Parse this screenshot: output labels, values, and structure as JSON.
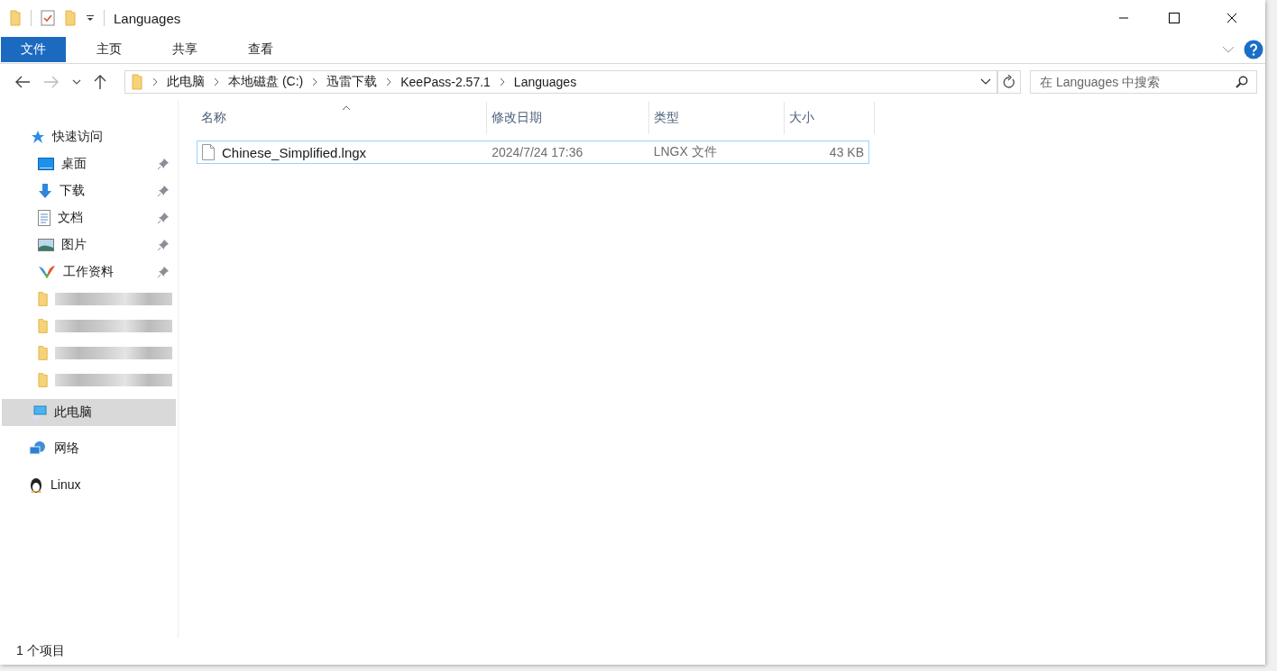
{
  "window": {
    "title": "Languages"
  },
  "ribbon_tabs": [
    {
      "label": "文件",
      "selected": true
    },
    {
      "label": "主页",
      "selected": false
    },
    {
      "label": "共享",
      "selected": false
    },
    {
      "label": "查看",
      "selected": false
    }
  ],
  "address": {
    "path": [
      "此电脑",
      "本地磁盘 (C:)",
      "迅雷下载",
      "KeePass-2.57.1",
      "Languages"
    ]
  },
  "search": {
    "placeholder": "在 Languages 中搜索"
  },
  "sidebar": {
    "quick_access": {
      "label": "快速访问",
      "children": [
        {
          "kind": "pinned",
          "label": "桌面"
        },
        {
          "kind": "pinned",
          "label": "下载"
        },
        {
          "kind": "pinned",
          "label": "文档"
        },
        {
          "kind": "pinned",
          "label": "图片"
        },
        {
          "kind": "pinned",
          "label": "工作资料"
        },
        {
          "kind": "redacted"
        },
        {
          "kind": "redacted"
        },
        {
          "kind": "redacted"
        },
        {
          "kind": "redacted"
        }
      ]
    },
    "items": [
      {
        "label": "此电脑",
        "selected": true
      },
      {
        "label": "网络",
        "selected": false
      },
      {
        "label": "Linux",
        "selected": false
      }
    ]
  },
  "table": {
    "columns": [
      {
        "label": "名称",
        "sorted": true
      },
      {
        "label": "修改日期",
        "sorted": false
      },
      {
        "label": "类型",
        "sorted": false
      },
      {
        "label": "大小",
        "sorted": false
      }
    ],
    "rows": [
      {
        "cells": [
          "Chinese_Simplified.lngx",
          "2024/7/24 17:36",
          "LNGX 文件",
          "43 KB"
        ],
        "focused": true
      }
    ]
  },
  "status_bar": "1 个项目"
}
